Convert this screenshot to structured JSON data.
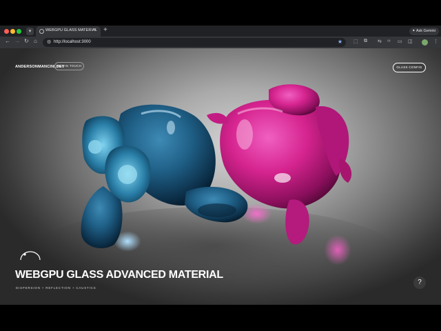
{
  "browser": {
    "tab_title": "WEBGPU GLASS MATERIAL",
    "tab_close": "×",
    "new_tab": "+",
    "ask_gemini": "Ask Gemini",
    "url": "http://localhost:3000"
  },
  "page": {
    "brand": "ANDERSONMANCINI.DEV",
    "get_in_touch": "GET IN TOUCH",
    "glass_config": "GLASS CONFIG",
    "title": "WEBGPU GLASS ADVANCED MATERIAL",
    "subtitle": "DISPERSION + REFLECTION + CAUSTICS",
    "help": "?"
  },
  "colors": {
    "accent_pink": "#d6248f",
    "accent_blue": "#1f5f86",
    "chrome_bg": "#202124"
  },
  "icons": [
    "back-arrow-icon",
    "forward-arrow-icon",
    "reload-icon",
    "home-icon",
    "site-info-icon",
    "bookmark-star-icon",
    "extensions-icon",
    "profile-avatar-icon",
    "menu-dots-icon"
  ]
}
